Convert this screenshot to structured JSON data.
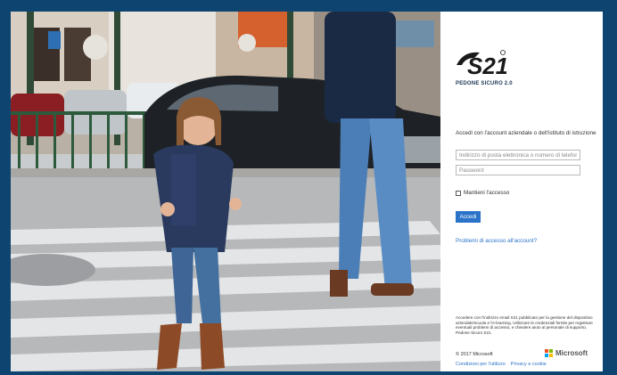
{
  "brand": {
    "logo_text": "S21",
    "subtitle": "PEDONE SICURO 2.0"
  },
  "login": {
    "intro": "Accedi con l'account aziendale o dell'istituto di istruzione",
    "username_placeholder": "Indirizzo di posta elettronica o numero di telefono",
    "password_placeholder": "Password",
    "remember_label": "Mantieni l'accesso",
    "submit_label": "Accedi",
    "forgot_link": "Problemi di accesso all'account?"
  },
  "footer": {
    "notice": "Accedere con l'indirizzo email S21 pubblicato per la gestione del dispositivo aziendale/scuola e l'e-learning. Utilizzare le credenziali fornite per registrare eventuali problemi di accesso, e chiedere aiuto al personale di supporto, Pedone Sicuro S21.",
    "copyright": "© 2017 Microsoft",
    "terms": "Condizioni per l'utilizzo",
    "privacy": "Privacy e cookie",
    "ms_wordmark": "Microsoft"
  },
  "colors": {
    "background": "#0e4470",
    "accent": "#2a73c9",
    "ms_red": "#f25022",
    "ms_green": "#7fba00",
    "ms_blue": "#00a4ef",
    "ms_yellow": "#ffb900"
  },
  "icons": {
    "checkbox": "checkbox-empty",
    "ms_logo": "microsoft-four-squares"
  }
}
